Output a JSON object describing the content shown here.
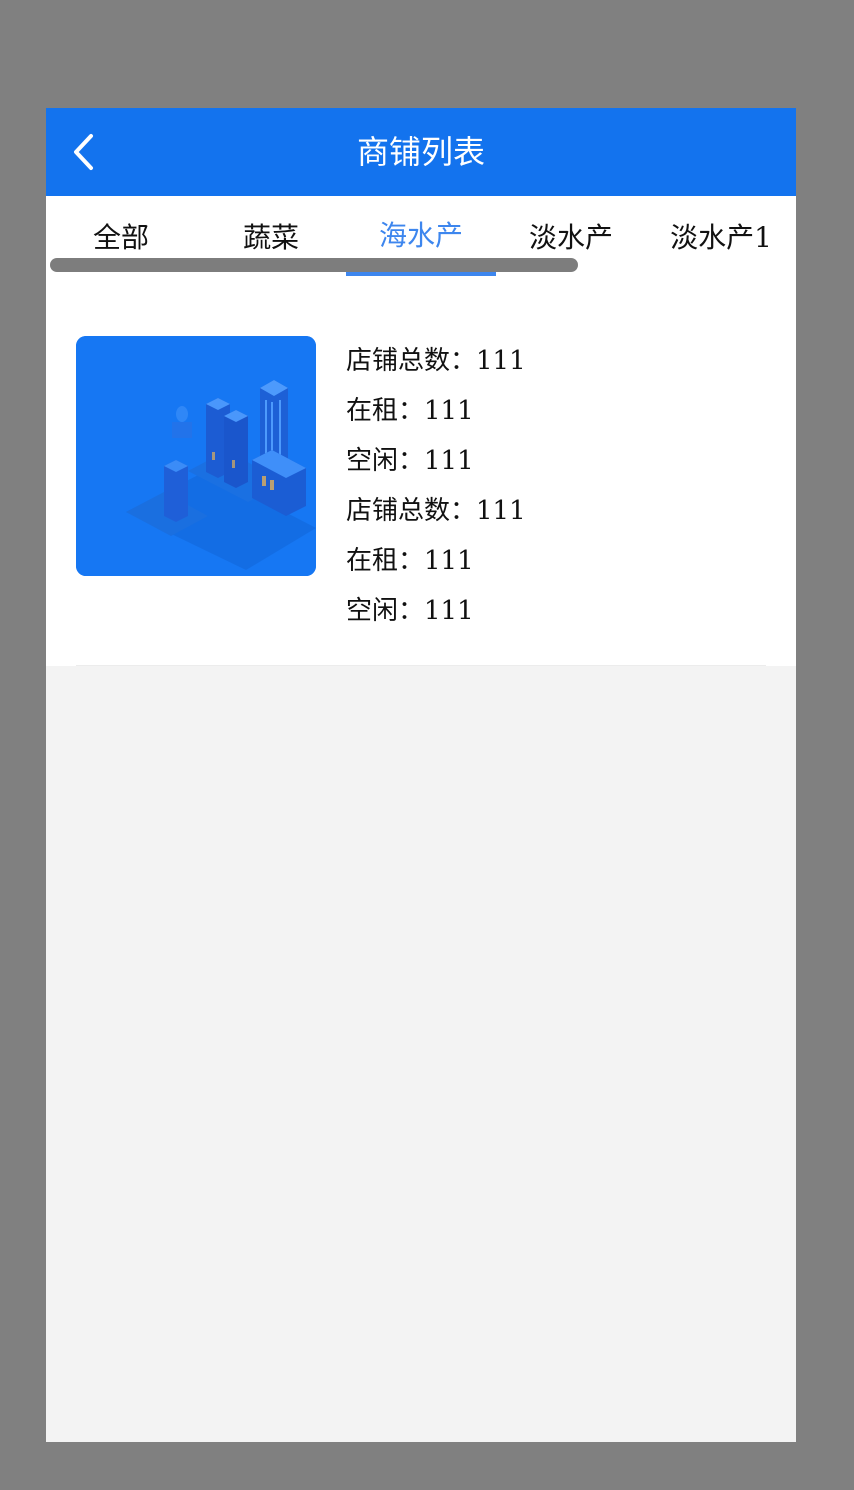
{
  "header": {
    "title": "商铺列表"
  },
  "tabs": [
    {
      "label": "全部"
    },
    {
      "label": "蔬菜"
    },
    {
      "label": "海水产"
    },
    {
      "label": "淡水产"
    },
    {
      "label": "淡水产1"
    }
  ],
  "active_tab": "海水产",
  "shop": {
    "rows": [
      {
        "label": "店铺总数：",
        "value": "111"
      },
      {
        "label": "在租：",
        "value": "111"
      },
      {
        "label": "空闲：",
        "value": "111"
      },
      {
        "label": "店铺总数：",
        "value": "111"
      },
      {
        "label": "在租：",
        "value": "111"
      },
      {
        "label": "空闲：",
        "value": "111"
      }
    ]
  },
  "colors": {
    "header_bg": "#1373ee",
    "tab_active": "#3d86ee",
    "page_bg": "#f3f3f3",
    "backdrop": "#808080"
  },
  "icons": {
    "back": "chevron-left-icon",
    "shop_image": "city-buildings-illustration"
  }
}
